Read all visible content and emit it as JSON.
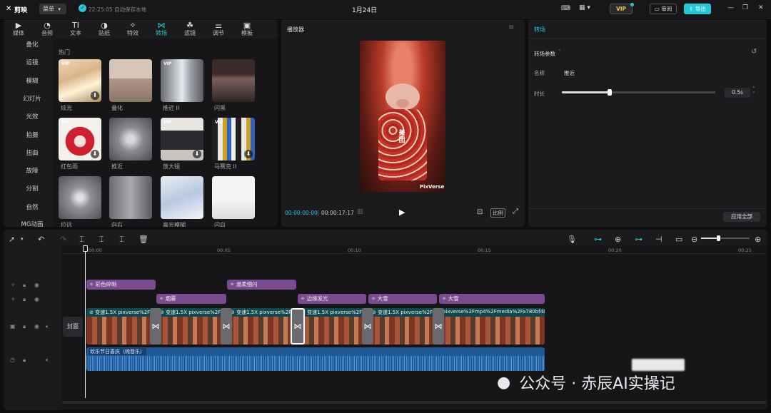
{
  "titlebar": {
    "app_name": "剪映",
    "menu_label": "菜单",
    "save_status": "22:25:05 自动保存本地",
    "project_title": "1月24日",
    "vip_label": "VIP",
    "review_label": "审阅",
    "export_label": "导出"
  },
  "toolbar": [
    {
      "label": "媒体",
      "icon": "media-icon"
    },
    {
      "label": "音频",
      "icon": "audio-icon"
    },
    {
      "label": "文本",
      "icon": "text-icon"
    },
    {
      "label": "贴纸",
      "icon": "sticker-icon"
    },
    {
      "label": "特效",
      "icon": "effects-icon"
    },
    {
      "label": "转场",
      "icon": "transition-icon"
    },
    {
      "label": "滤镜",
      "icon": "filter-icon"
    },
    {
      "label": "调节",
      "icon": "adjust-icon"
    },
    {
      "label": "模板",
      "icon": "template-icon"
    }
  ],
  "active_tool": "转场",
  "categories": [
    "叠化",
    "运镜",
    "模糊",
    "幻灯片",
    "光效",
    "拍摄",
    "扭曲",
    "故障",
    "分割",
    "自然",
    "MG动画"
  ],
  "section_title": "热门",
  "transitions": [
    {
      "label": "炫光",
      "vip": true,
      "download": true
    },
    {
      "label": "叠化",
      "vip": false,
      "download": false
    },
    {
      "label": "推近 II",
      "vip": true,
      "download": false
    },
    {
      "label": "闪黑",
      "vip": false,
      "download": false
    },
    {
      "label": "红包雨",
      "vip": true,
      "download": true
    },
    {
      "label": "推近",
      "vip": false,
      "download": false
    },
    {
      "label": "放大镜",
      "vip": true,
      "download": true
    },
    {
      "label": "马赛克 II",
      "vip": true,
      "download": true
    },
    {
      "label": "拉远",
      "vip": false,
      "download": false
    },
    {
      "label": "向右",
      "vip": false,
      "download": false
    },
    {
      "label": "高光模糊",
      "vip": false,
      "download": false
    },
    {
      "label": "闪白",
      "vip": false,
      "download": false
    }
  ],
  "player": {
    "title": "播放器",
    "current_time": "00:00:00:00",
    "total_time": "00:00:17:17",
    "ratio_label": "比例",
    "watermark": "PixVerse",
    "frame_text": "美团"
  },
  "inspector": {
    "tab": "转场",
    "section": "转场参数",
    "name_label": "名称",
    "name_value": "推近",
    "duration_label": "时长",
    "duration_value": "0.5s",
    "duration_slider_fraction": 0.31,
    "apply_all": "应用全部"
  },
  "timeline": {
    "zoom_fraction": 0.35,
    "ticks": [
      "00:00",
      "00:05",
      "00:10",
      "00:15",
      "00:20",
      "00:25"
    ],
    "cover_label": "封面",
    "effect_track1": [
      "彩色碎晰",
      "温柔细闪"
    ],
    "effect_track2": [
      "烟雾",
      "边缘发光",
      "大雪",
      "大雪"
    ],
    "clips": [
      {
        "speed": "变速1.5X",
        "name": "pixverse%2F"
      },
      {
        "speed": "变速1.5X",
        "name": "pixverse%2F"
      },
      {
        "speed": "变速1.5X",
        "name": "pixverse%2F"
      },
      {
        "speed": "变速1.5X",
        "name": "pixverse%2F"
      },
      {
        "speed": "变速1.5X",
        "name": "pixverse%2F"
      },
      {
        "speed": "",
        "name": "pixverse%2Fmp4%2Fmedia%2Fa780bf4b"
      }
    ],
    "audio_label": "欢乐节日喜庆（纯音乐）"
  },
  "overlay": {
    "watermark_text": "公众号 · 赤辰AI实操记"
  },
  "colors": {
    "accent": "#25c8d8",
    "effect_bar": "#7a4c8f",
    "video_track": "#12484d",
    "audio_track": "#1f5a96"
  }
}
